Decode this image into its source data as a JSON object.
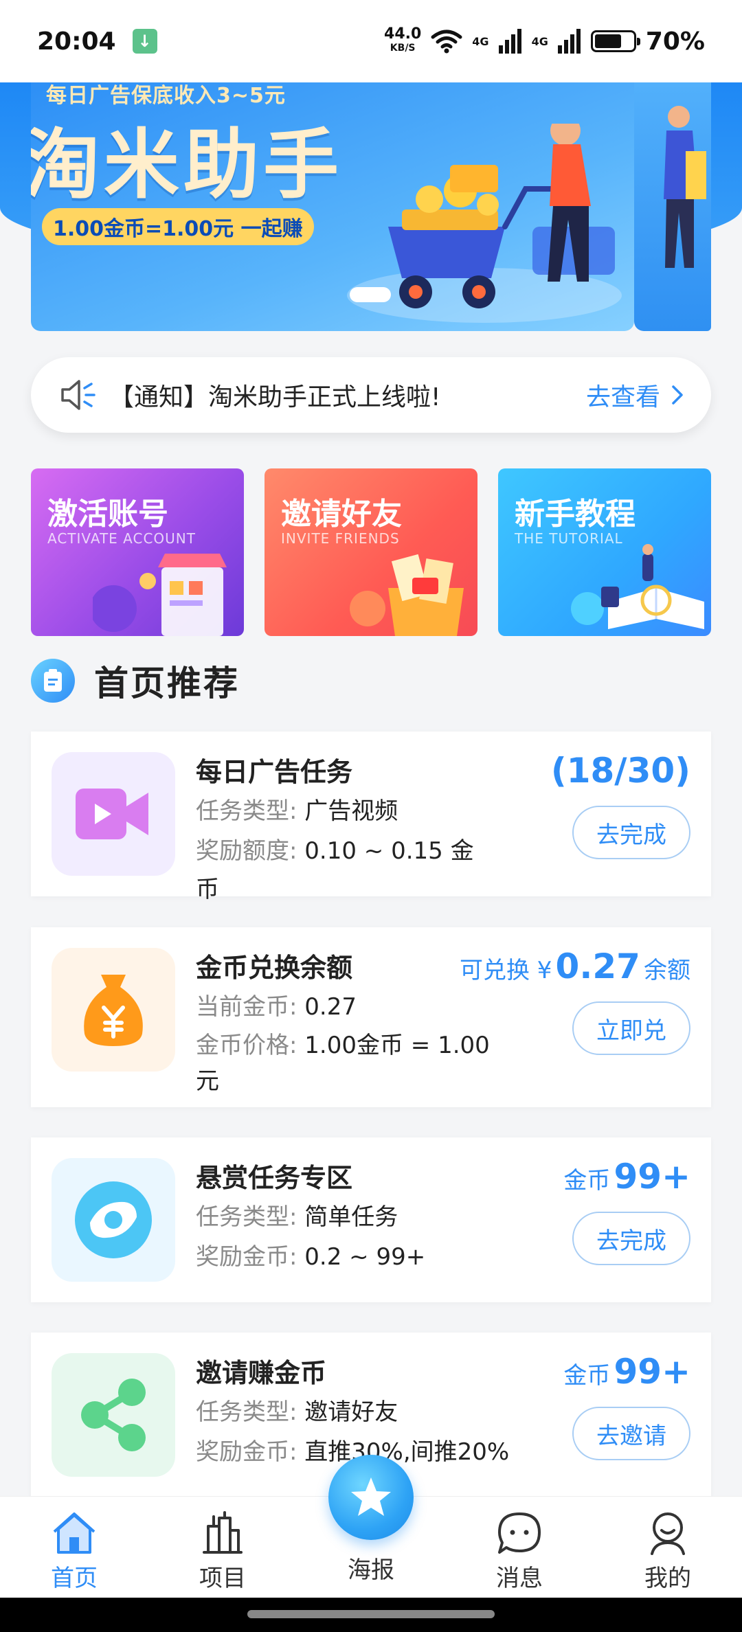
{
  "status": {
    "time": "20:04",
    "speed_value": "44.0",
    "speed_unit": "KB/S",
    "net1": "4G",
    "net2": "4G",
    "battery": "70%"
  },
  "banner": {
    "subtitle": "每日广告保底收入3~5元",
    "title": "淘米助手",
    "pill": "1.00金币=1.00元 一起赚"
  },
  "notice": {
    "text": "【通知】淘米助手正式上线啦!",
    "link": "去查看"
  },
  "quick_cards": [
    {
      "title": "激活账号",
      "subtitle": "ACTIVATE ACCOUNT"
    },
    {
      "title": "邀请好友",
      "subtitle": "INVITE FRIENDS"
    },
    {
      "title": "新手教程",
      "subtitle": "THE TUTORIAL"
    }
  ],
  "section": {
    "title": "首页推荐"
  },
  "tasks": [
    {
      "title": "每日广告任务",
      "line1_key": "任务类型:",
      "line1_val": "广告视频",
      "line2_key": "奖励额度:",
      "line2_val": "0.10 ~ 0.15 金币",
      "stat": "(18/30)",
      "action": "去完成"
    },
    {
      "title": "金币兑换余额",
      "line1_key": "当前金币:",
      "line1_val": "0.27",
      "line2_key": "金币价格:",
      "line2_val": "1.00金币 = 1.00元",
      "stat_prefix": "可兑换 ¥",
      "stat_big": "0.27",
      "stat_suffix": "余额",
      "action": "立即兑"
    },
    {
      "title": "悬赏任务专区",
      "line1_key": "任务类型:",
      "line1_val": "简单任务",
      "line2_key": "奖励金币:",
      "line2_val": "0.2 ~ 99+",
      "stat_prefix": "金币",
      "stat_big": "99+",
      "action": "去完成"
    },
    {
      "title": "邀请赚金币",
      "line1_key": "任务类型:",
      "line1_val": "邀请好友",
      "line2_key": "奖励金币:",
      "line2_val": "直推30%,间推20%",
      "stat_prefix": "金币",
      "stat_big": "99+",
      "action": "去邀请"
    }
  ],
  "nav": {
    "home": "首页",
    "project": "项目",
    "poster": "海报",
    "message": "消息",
    "mine": "我的"
  },
  "colors": {
    "accent": "#2f8df6",
    "banner": "#2d8ff6"
  }
}
